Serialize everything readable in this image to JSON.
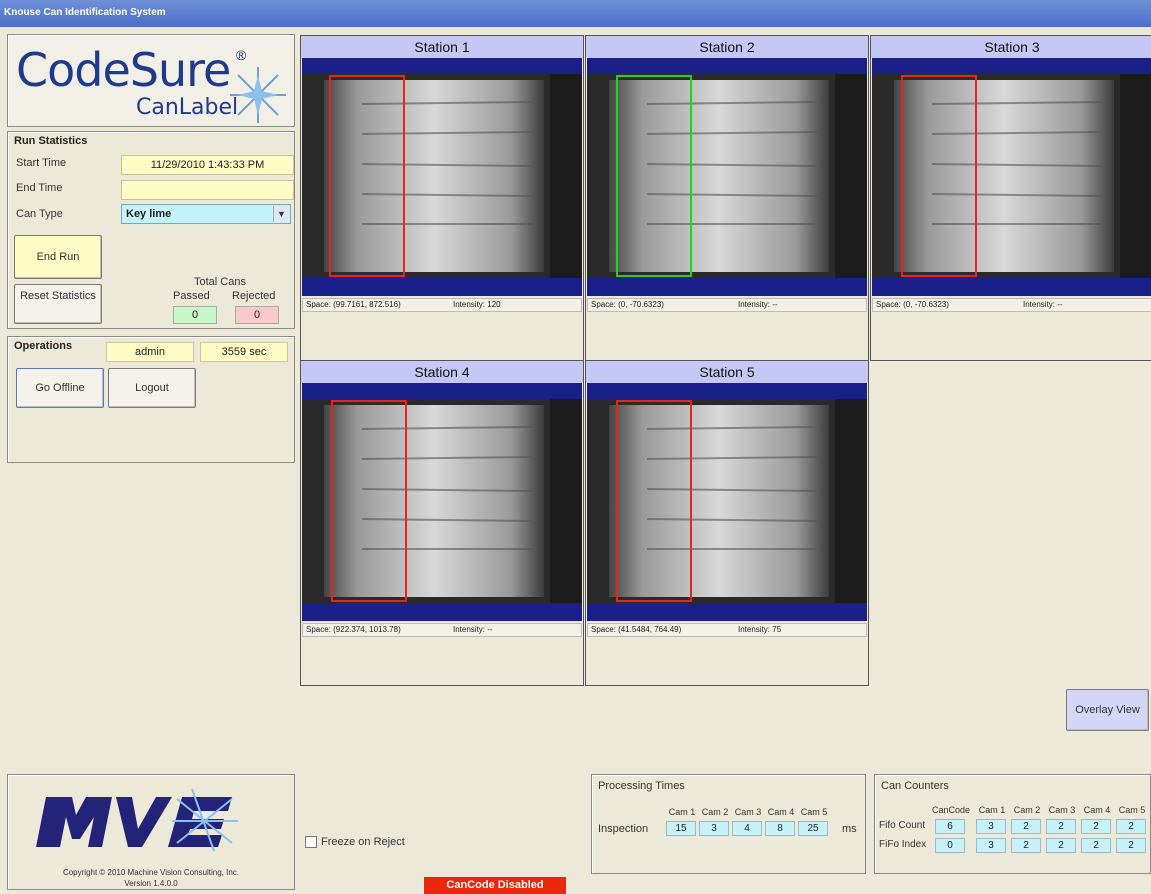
{
  "window": {
    "title": "Knouse Can Identification System"
  },
  "logo": {
    "main": "CodeSure",
    "reg": "®",
    "sub": "CanLabel"
  },
  "run_statistics": {
    "title": "Run Statistics",
    "start_time_label": "Start Time",
    "start_time_value": "11/29/2010  1:43:33 PM",
    "end_time_label": "End Time",
    "end_time_value": "",
    "can_type_label": "Can Type",
    "can_type_value": "Key lime",
    "end_run_button": "End Run",
    "reset_button": "Reset Statistics",
    "total_cans_label": "Total Cans",
    "passed_label": "Passed",
    "rejected_label": "Rejected",
    "passed_value": "0",
    "rejected_value": "0"
  },
  "operations": {
    "title": "Operations",
    "user": "admin",
    "elapsed": "3559 sec",
    "go_offline_button": "Go Offline",
    "logout_button": "Logout"
  },
  "stations": [
    {
      "title": "Station 1",
      "coord": "Space: (99.7161, 872.516)",
      "intensity": "Intensity: 120",
      "roi": "red"
    },
    {
      "title": "Station 2",
      "coord": "Space: (0, -70.6323)",
      "intensity": "Intensity: --",
      "roi": "green"
    },
    {
      "title": "Station 3",
      "coord": "Space: (0, -70.6323)",
      "intensity": "Intensity: --",
      "roi": "red"
    },
    {
      "title": "Station 4",
      "coord": "Space: (922.374, 1013.78)",
      "intensity": "Intensity: --",
      "roi": "red"
    },
    {
      "title": "Station 5",
      "coord": "Space: (41.5484, 764.49)",
      "intensity": "Intensity: 75",
      "roi": "red"
    }
  ],
  "overlay_button": "Overlay View",
  "freeze_on_reject": {
    "label": "Freeze on Reject",
    "checked": false
  },
  "status_badge": "CanCode Disabled",
  "bottom_logo": {
    "copyright": "Copyright © 2010   Machine Vision Consulting,  Inc.",
    "version": "Version 1.4.0.0"
  },
  "processing_times": {
    "title": "Processing Times",
    "columns": [
      "Cam 1",
      "Cam 2",
      "Cam 3",
      "Cam 4",
      "Cam 5"
    ],
    "row_label": "Inspection",
    "values": [
      "15",
      "3",
      "4",
      "8",
      "25"
    ],
    "unit": "ms"
  },
  "can_counters": {
    "title": "Can Counters",
    "columns": [
      "CanCode",
      "Cam 1",
      "Cam 2",
      "Cam 3",
      "Cam 4",
      "Cam 5"
    ],
    "rows": [
      {
        "label": "Fifo Count",
        "values": [
          "6",
          "3",
          "2",
          "2",
          "2",
          "2"
        ]
      },
      {
        "label": "FiFo Index",
        "values": [
          "0",
          "3",
          "2",
          "2",
          "2",
          "2"
        ]
      }
    ]
  },
  "colors": {
    "title_bar": "#4a6fc6",
    "station_header": "#c5c7f4",
    "field_yellow": "#fffcc6",
    "field_cyan": "#c6f2f8",
    "badge_red": "#e8270d",
    "roi_red": "#e8251b",
    "roi_green": "#22d31c"
  }
}
